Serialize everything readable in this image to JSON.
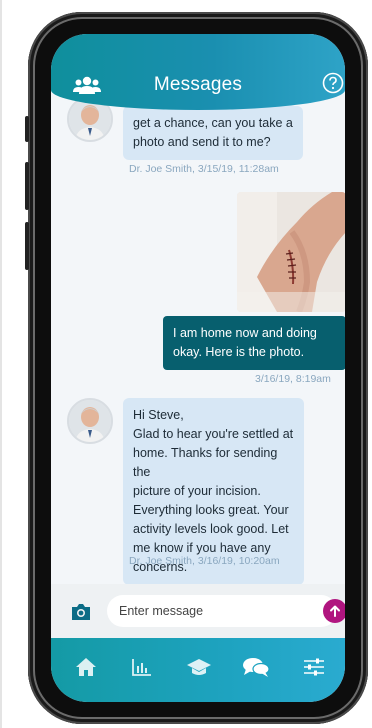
{
  "header": {
    "title": "Messages",
    "left_icon": "patients-group-icon",
    "right_icon": "help-icon"
  },
  "messages": [
    {
      "direction": "incoming",
      "text_lines": [
        "get a chance, can you take a",
        "photo and send it to me?"
      ],
      "meta": "Dr. Joe Smith, 3/15/19, 11:28am"
    },
    {
      "direction": "outgoing",
      "attachment": "incision-photo",
      "text_lines": [
        "I am home now and doing",
        "okay. Here is the photo."
      ],
      "meta": "3/16/19, 8:19am"
    },
    {
      "direction": "incoming",
      "text_lines": [
        "Hi Steve,",
        "Glad to hear you're settled at",
        "home. Thanks for sending the",
        "picture of your incision.",
        "Everything looks great. Your",
        "activity levels look good. Let",
        "me know if you have any",
        "concerns."
      ],
      "meta": "Dr. Joe Smith, 3/16/19, 10:20am"
    }
  ],
  "composer": {
    "placeholder": "Enter message",
    "camera_icon": "camera-icon",
    "send_icon": "send-arrow-icon"
  },
  "tabs": [
    {
      "icon": "home-icon"
    },
    {
      "icon": "activity-chart-icon"
    },
    {
      "icon": "education-cap-icon"
    },
    {
      "icon": "messages-icon",
      "active": true
    },
    {
      "icon": "settings-sliders-icon"
    }
  ],
  "colors": {
    "header": "#1a8fb0",
    "incoming_bubble": "#d7e7f5",
    "outgoing_bubble": "#075f6e",
    "send_button": "#b0157f",
    "meta_text": "#8aa7bf"
  }
}
